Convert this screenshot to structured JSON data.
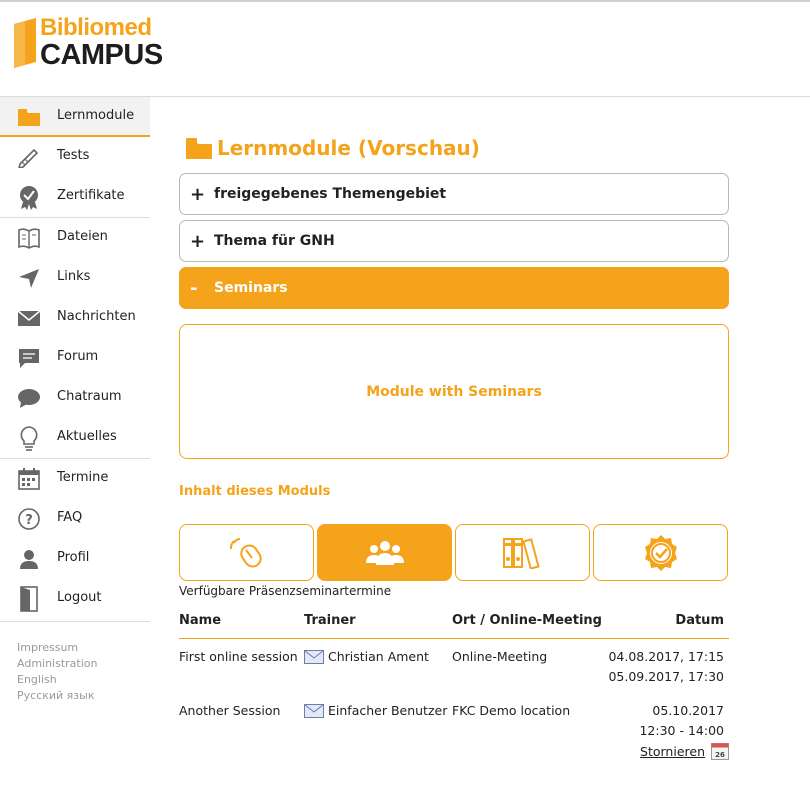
{
  "brand": {
    "line1": "Bibliomed",
    "line2": "CAMPUS"
  },
  "sidebar": {
    "items": [
      {
        "label": "Lernmodule",
        "icon": "folder-icon"
      },
      {
        "label": "Tests",
        "icon": "pencil-icon"
      },
      {
        "label": "Zertifikate",
        "icon": "certificate-icon"
      },
      {
        "label": "Dateien",
        "icon": "book-icon"
      },
      {
        "label": "Links",
        "icon": "send-icon"
      },
      {
        "label": "Nachrichten",
        "icon": "envelope-icon"
      },
      {
        "label": "Forum",
        "icon": "forum-icon"
      },
      {
        "label": "Chatraum",
        "icon": "chat-bubble-icon"
      },
      {
        "label": "Aktuelles",
        "icon": "lightbulb-icon"
      },
      {
        "label": "Termine",
        "icon": "calendar-icon"
      },
      {
        "label": "FAQ",
        "icon": "question-icon"
      },
      {
        "label": "Profil",
        "icon": "person-icon"
      },
      {
        "label": "Logout",
        "icon": "door-icon"
      }
    ],
    "footer": [
      "Impressum",
      "Administration",
      "English",
      "Русский язык"
    ]
  },
  "main": {
    "title": "Lernmodule (Vorschau)",
    "accordion": [
      {
        "sign": "+",
        "label": "freigegebenes Themengebiet"
      },
      {
        "sign": "+",
        "label": "Thema für GNH"
      },
      {
        "sign": "-",
        "label": "Seminars"
      }
    ],
    "module_description": "Module with Seminars",
    "content_heading": "Inhalt dieses Moduls",
    "tabs": [
      "mouse-click-icon",
      "group-icon",
      "library-binders-icon",
      "certificate-check-icon"
    ],
    "available_label": "Verfügbare Präsenzseminartermine",
    "table": {
      "headers": {
        "name": "Name",
        "trainer": "Trainer",
        "location": "Ort / Online-Meeting",
        "date": "Datum"
      },
      "rows": [
        {
          "name": "First online session",
          "trainer": "Christian Ament",
          "location": "Online-Meeting",
          "date1": "04.08.2017, 17:15",
          "date2": "05.09.2017, 17:30"
        },
        {
          "name": "Another Session",
          "trainer": "Einfacher Benutzer",
          "location": "FKC Demo location",
          "date1": "05.10.2017",
          "date2": "12:30 - 14:00",
          "action": "Stornieren",
          "calendar_day": "26"
        }
      ]
    }
  },
  "colors": {
    "accent": "#f5a31a",
    "text": "#222222",
    "muted": "#999999"
  }
}
